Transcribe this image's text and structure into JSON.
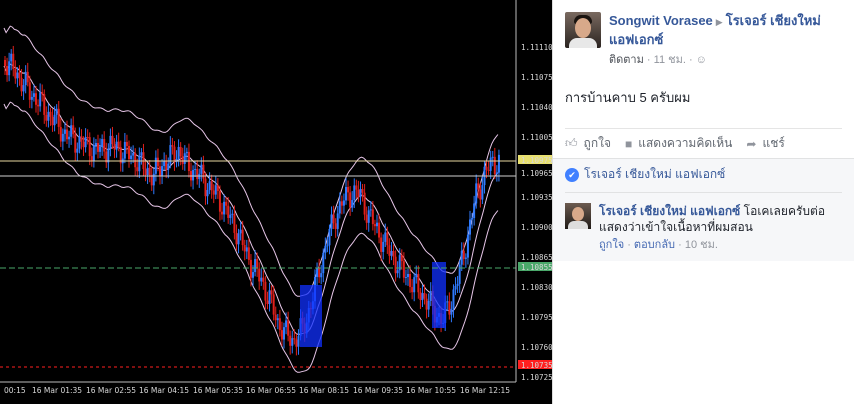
{
  "chart": {
    "price_labels": [
      "1.11110",
      "1.11075",
      "1.11040",
      "1.11005",
      "1.10975",
      "1.10965",
      "1.10935",
      "1.10900",
      "1.10865",
      "1.10855",
      "1.10830",
      "1.10795",
      "1.10760",
      "1.10735",
      "1.10725"
    ],
    "time_labels": [
      "00:15",
      "16 Mar 01:35",
      "16 Mar 02:55",
      "16 Mar 04:15",
      "16 Mar 05:35",
      "16 Mar 06:55",
      "16 Mar 08:15",
      "16 Mar 09:35",
      "16 Mar 10:55",
      "16 Mar 12:15"
    ],
    "colors": {
      "bull": "#2f7bff",
      "bear": "#e0201c",
      "band": "#e7c6e8",
      "hline": "#e8d8a0",
      "green_line": "#4aa86a",
      "red_line": "#ff2020"
    }
  },
  "post": {
    "author": "Songwit Vorasee",
    "page": "โรเจอร์ เชียงใหม่ แอฟเอกซ์",
    "follow": "ติดตาม",
    "time": "11 ชม.",
    "text": "การบ้านคาบ 5 ครับผม",
    "actions": {
      "like": "ถูกใจ",
      "comment": "แสดงความคิดเห็น",
      "share": "แชร์"
    }
  },
  "likes": {
    "text": "โรเจอร์ เชียงใหม่ แอฟเอกซ์"
  },
  "comment": {
    "author": "โรเจอร์ เชียงใหม่ แอฟเอกซ์",
    "text": "โอเคเลยครับต่อ แสดงว่าเข้าใจเนื้อหาที่ผมสอน",
    "like": "ถูกใจ",
    "reply": "ตอบกลับ",
    "time": "10 ชม."
  }
}
